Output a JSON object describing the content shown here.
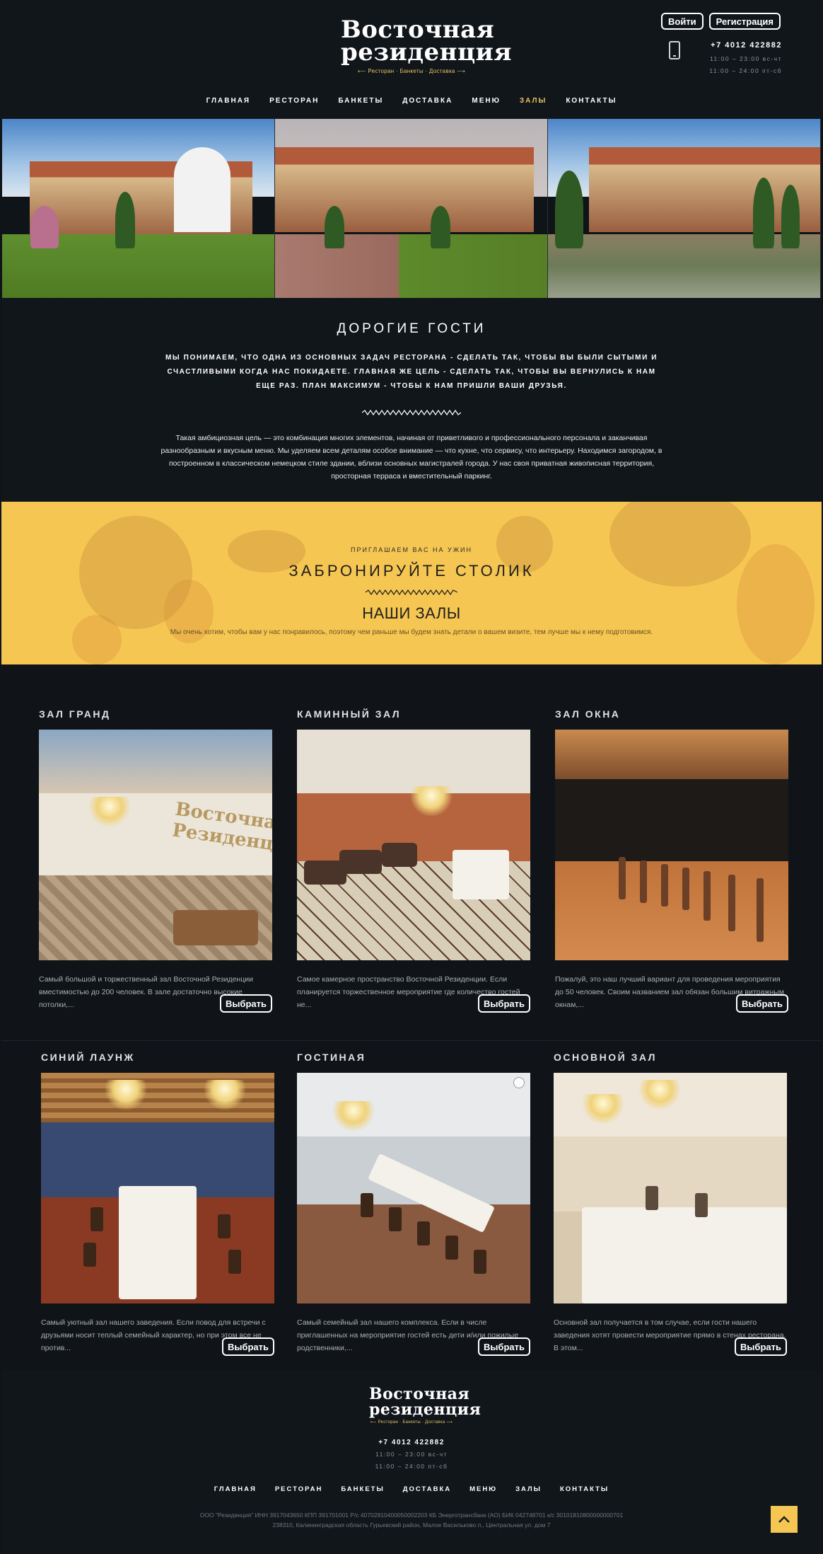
{
  "header": {
    "logo": {
      "line1": "Восточная",
      "line2": "резиденция",
      "tagline": "Ресторан · Банкеты · Доставка"
    },
    "auth": {
      "login": "Войти",
      "register": "Регистрация"
    },
    "contact": {
      "phone": "+7 4012 422882",
      "hours_weekdays": "11:00 – 23:00 вс-чт",
      "hours_weekend": "11:00 – 24:00 пт-сб"
    },
    "nav": [
      {
        "label": "ГЛАВНАЯ",
        "active": false
      },
      {
        "label": "РЕСТОРАН",
        "active": false
      },
      {
        "label": "БАНКЕТЫ",
        "active": false
      },
      {
        "label": "ДОСТАВКА",
        "active": false
      },
      {
        "label": "МЕНЮ",
        "active": false
      },
      {
        "label": "ЗАЛЫ",
        "active": true
      },
      {
        "label": "КОНТАКТЫ",
        "active": false
      }
    ]
  },
  "welcome": {
    "title": "ДОРОГИЕ ГОСТИ",
    "lead": "МЫ ПОНИМАЕМ, ЧТО ОДНА ИЗ ОСНОВНЫХ ЗАДАЧ РЕСТОРАНА - СДЕЛАТЬ ТАК, ЧТОБЫ ВЫ БЫЛИ СЫТЫМИ И СЧАСТЛИВЫМИ КОГДА НАС ПОКИДАЕТЕ. ГЛАВНАЯ ЖЕ ЦЕЛЬ - СДЕЛАТЬ ТАК, ЧТОБЫ ВЫ ВЕРНУЛИСЬ К НАМ ЕЩЕ РАЗ. ПЛАН МАКСИМУМ - ЧТОБЫ К НАМ ПРИШЛИ ВАШИ ДРУЗЬЯ.",
    "body": "Такая амбициозная цель  — это комбинация многих элементов, начиная от приветливого и профессионального персонала и заканчивая разнообразным и вкусным меню. Мы уделяем всем деталям особое внимание  — что кухне, что сервису, что интерьеру. Находимся загородом, в построенном в классическом немецком стиле здании, вблизи основных магистралей города. У нас своя приватная живописная территория, просторная терраса и вместительный паркинг."
  },
  "reserve": {
    "kicker": "ПРИГЛАШАЕМ ВАС НА УЖИН",
    "title": "ЗАБРОНИРУЙТЕ СТОЛИК",
    "subtitle": "НАШИ ЗАЛЫ",
    "note": "Мы очень хотим, чтобы вам у нас понравилось, поэтому чем раньше мы будем знать детали о вашем визите, тем лучше мы к нему подготовимся."
  },
  "halls": [
    {
      "title": "ЗАЛ ГРАНД",
      "desc": "Самый большой и торжественный зал Восточной Резиденции вместимостью до 200 человек.  В зале достаточно высокие потолки,...",
      "button": "Выбрать",
      "wall_text": "Восточная Резиденция"
    },
    {
      "title": "КАМИННЫЙ ЗАЛ",
      "desc": "Самое камерное пространство Восточной Резиденции. Если планируется торжественное мероприятие где количество гостей не...",
      "button": "Выбрать"
    },
    {
      "title": "ЗАЛ ОКНА",
      "desc": "Пожалуй, это наш лучший вариант для проведения мероприятия до 50 человек. Своим названием зал обязан большим витражным окнам,...",
      "button": "Выбрать"
    },
    {
      "title": "СИНИЙ ЛАУНЖ",
      "desc": "Самый уютный зал нашего заведения. Если повод для встречи с друзьями носит теплый семейный характер, но при этом все не против...",
      "button": "Выбрать"
    },
    {
      "title": "ГОСТИНАЯ",
      "desc": "Самый семейный зал нашего комплекса. Если в числе приглашенных на мероприятие гостей есть дети и/или пожилые родственники,...",
      "button": "Выбрать"
    },
    {
      "title": "ОСНОВНОЙ ЗАЛ",
      "desc": "Основной зал получается в том случае, если гости нашего заведения хотят провести мероприятие прямо в стенах ресторана. В этом...",
      "button": "Выбрать"
    }
  ],
  "footer": {
    "logo": {
      "line1": "Восточная",
      "line2": "резиденция",
      "tagline": "Ресторан · Банкеты · Доставка"
    },
    "phone": "+7 4012 422882",
    "hours_weekdays": "11:00 – 23:00 вс-чт",
    "hours_weekend": "11:00 – 24:00 пт-сб",
    "nav": [
      "ГЛАВНАЯ",
      "РЕСТОРАН",
      "БАНКЕТЫ",
      "ДОСТАВКА",
      "МЕНЮ",
      "ЗАЛЫ",
      "КОНТАКТЫ"
    ],
    "legal": "ООО \"Резиденция\" ИНН 3917043650 КПП 391701001 Р/с 40702810400050002203 КБ Энерготрансбанк (АО) БИК 042748701 к/с 30101810800000000701",
    "address": "238310, Калининградская область Гурьевский район, Малое Васильково п., Центральная ул. дом 7"
  },
  "colors": {
    "background": "#0f1419",
    "accent": "#e8c064",
    "reserve_bg": "#f6c652"
  }
}
